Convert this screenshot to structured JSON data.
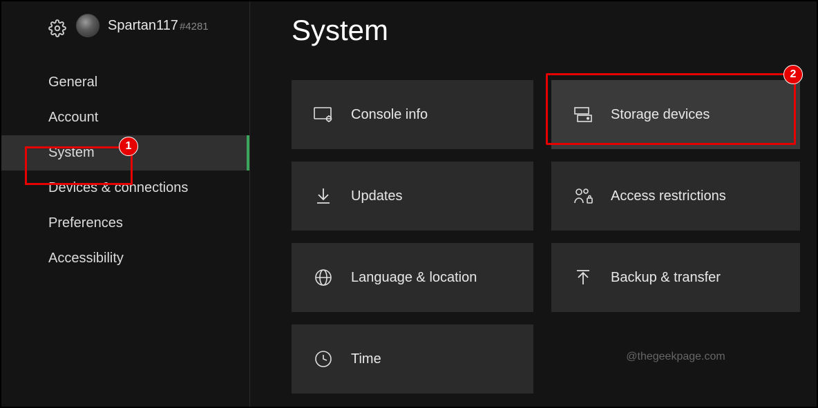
{
  "profile": {
    "username": "Spartan117",
    "tag": "#4281"
  },
  "sidebar": {
    "items": [
      {
        "label": "General"
      },
      {
        "label": "Account"
      },
      {
        "label": "System"
      },
      {
        "label": "Devices & connections"
      },
      {
        "label": "Preferences"
      },
      {
        "label": "Accessibility"
      }
    ]
  },
  "page": {
    "title": "System"
  },
  "tiles": [
    {
      "label": "Console info"
    },
    {
      "label": "Storage devices"
    },
    {
      "label": "Updates"
    },
    {
      "label": "Access restrictions"
    },
    {
      "label": "Language & location"
    },
    {
      "label": "Backup & transfer"
    },
    {
      "label": "Time"
    }
  ],
  "watermark": "@thegeekpage.com",
  "annotations": {
    "badge1": "1",
    "badge2": "2"
  }
}
